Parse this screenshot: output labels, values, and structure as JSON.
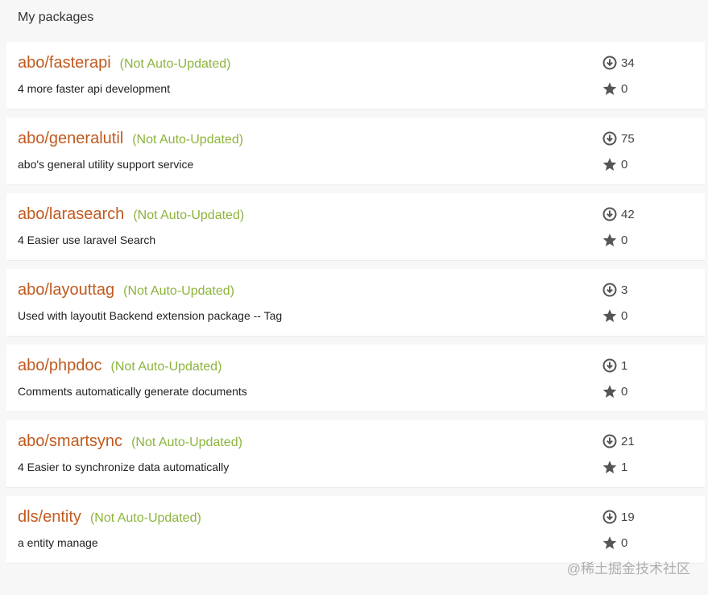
{
  "heading": "My packages",
  "colors": {
    "name": "#c15a1f",
    "status": "#8cb43c",
    "text": "#222222",
    "icon": "#555555"
  },
  "packages": [
    {
      "name": "abo/fasterapi",
      "status": "(Not Auto-Updated)",
      "description": "4 more faster api development",
      "downloads": "34",
      "favers": "0"
    },
    {
      "name": "abo/generalutil",
      "status": "(Not Auto-Updated)",
      "description": "abo's general utility support service",
      "downloads": "75",
      "favers": "0"
    },
    {
      "name": "abo/larasearch",
      "status": "(Not Auto-Updated)",
      "description": "4 Easier use laravel Search",
      "downloads": "42",
      "favers": "0"
    },
    {
      "name": "abo/layouttag",
      "status": "(Not Auto-Updated)",
      "description": "Used with layoutit Backend extension package -- Tag",
      "downloads": "3",
      "favers": "0"
    },
    {
      "name": "abo/phpdoc",
      "status": "(Not Auto-Updated)",
      "description": "Comments automatically generate documents",
      "downloads": "1",
      "favers": "0"
    },
    {
      "name": "abo/smartsync",
      "status": "(Not Auto-Updated)",
      "description": "4 Easier to synchronize data automatically",
      "downloads": "21",
      "favers": "1"
    },
    {
      "name": "dls/entity",
      "status": "(Not Auto-Updated)",
      "description": "a entity manage",
      "downloads": "19",
      "favers": "0"
    }
  ],
  "icons": {
    "downloads": "download-circle-icon",
    "favers": "star-icon"
  },
  "watermark": "@稀土掘金技术社区"
}
